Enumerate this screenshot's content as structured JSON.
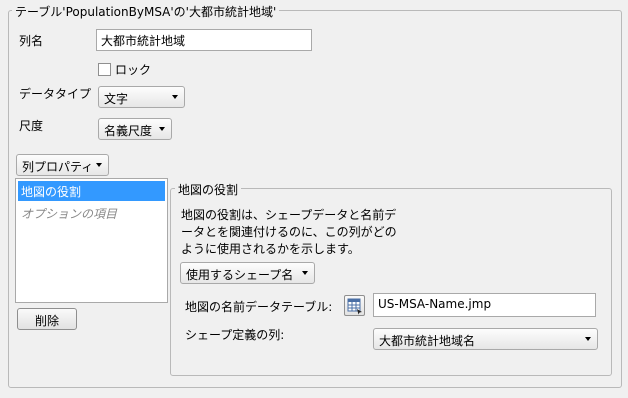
{
  "outer_group": {
    "title": "テーブル'PopulationByMSA'の'大都市統計地域'"
  },
  "column_name": {
    "label": "列名",
    "value": "大都市統計地域"
  },
  "lock": {
    "label": "ロック",
    "checked": false
  },
  "data_type": {
    "label": "データタイプ",
    "selected": "文字"
  },
  "scale": {
    "label": "尺度",
    "selected": "名義尺度"
  },
  "column_properties": {
    "dropdown_label": "列プロパティ",
    "items": [
      {
        "label": "地図の役割",
        "selected": true
      },
      {
        "label": "オプションの項目",
        "selected": false
      }
    ],
    "delete_label": "削除"
  },
  "map_role": {
    "title": "地図の役割",
    "description_lines": [
      "地図の役割は、シェープデータと名前デ",
      "ータとを関連付けるのに、この列がどの",
      "ように使用されるかを示します。"
    ],
    "role_select": "使用するシェープ名",
    "table_label": "地図の名前データテーブル:",
    "table_value": "US-MSA-Name.jmp",
    "shape_column_label": "シェープ定義の列:",
    "shape_column_value": "大都市統計地域名"
  },
  "icons": {
    "table_picker": "table-picker-icon",
    "checkbox": "checkbox-icon"
  }
}
